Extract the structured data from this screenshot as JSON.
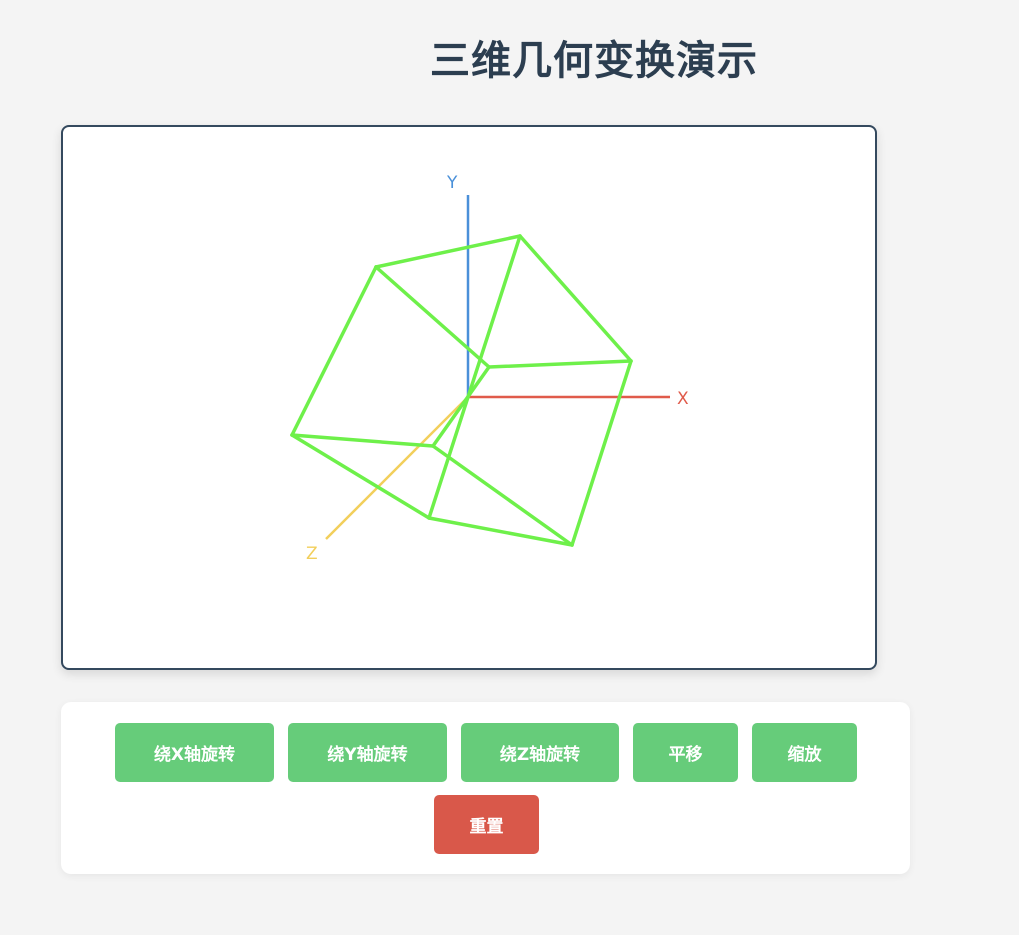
{
  "page": {
    "title": "三维几何变换演示"
  },
  "axes": {
    "x_label": "X",
    "y_label": "Y",
    "z_label": "Z",
    "x_color": "#e05b4b",
    "y_color": "#4a90d9",
    "z_color": "#f2cf5b"
  },
  "cube": {
    "edge_color": "#6ef04a"
  },
  "controls": {
    "rotate_x_label": "绕X轴旋转",
    "rotate_y_label": "绕Y轴旋转",
    "rotate_z_label": "绕Z轴旋转",
    "translate_label": "平移",
    "scale_label": "缩放",
    "reset_label": "重置"
  },
  "colors": {
    "primary_button": "#66cc7a",
    "reset_button": "#d9584a",
    "title": "#2c3e50"
  }
}
